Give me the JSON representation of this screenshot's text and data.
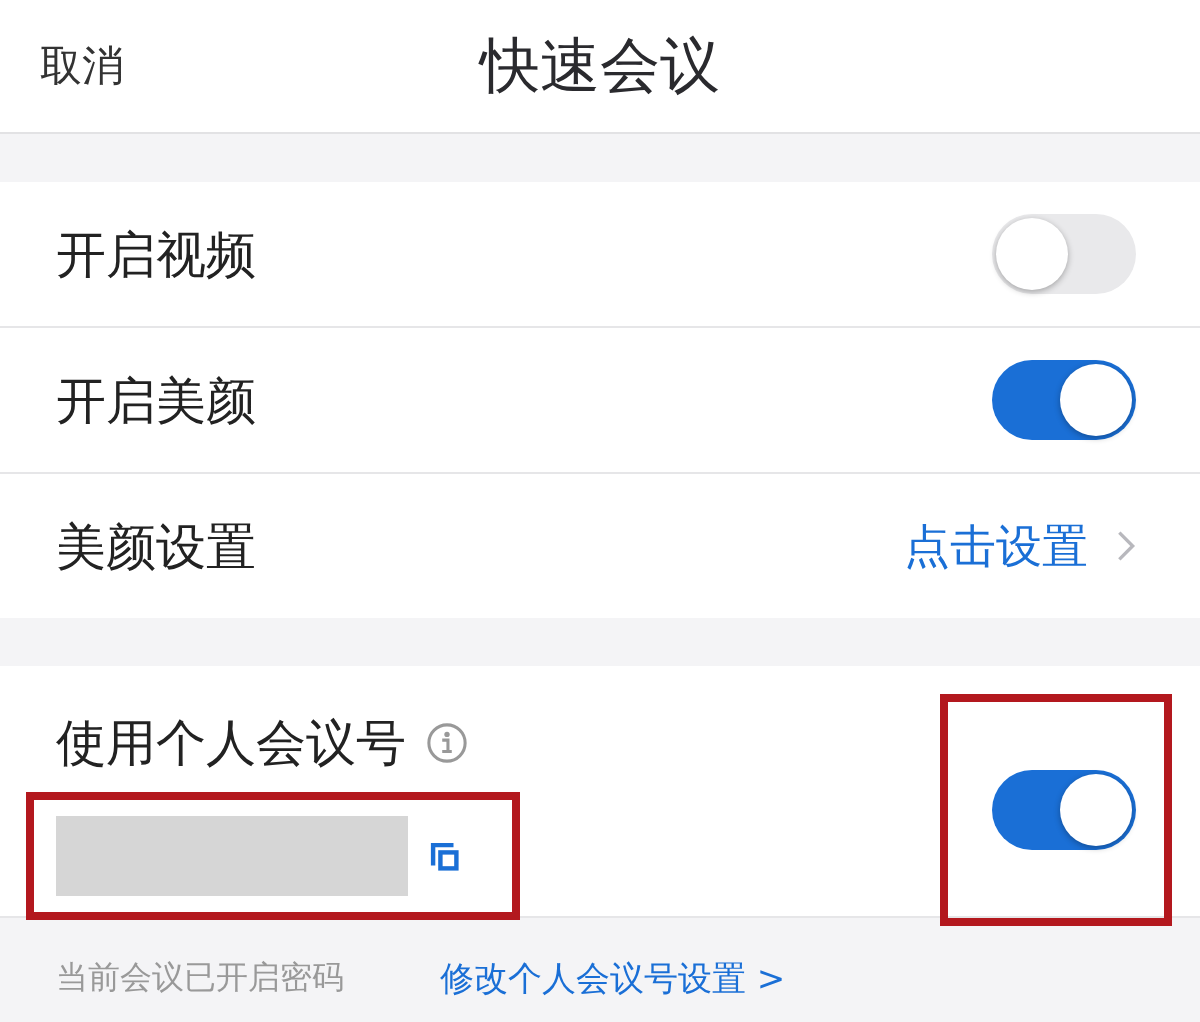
{
  "header": {
    "cancel": "取消",
    "title": "快速会议"
  },
  "settings": [
    {
      "kind": "toggle",
      "label": "开启视频",
      "on": false
    },
    {
      "kind": "toggle",
      "label": "开启美颜",
      "on": true
    },
    {
      "kind": "link",
      "label": "美颜设置",
      "value": "点击设置"
    }
  ],
  "personal": {
    "label": "使用个人会议号",
    "on": true,
    "number_highlighted": true,
    "toggle_highlighted": true
  },
  "footer": {
    "note": "当前会议已开启密码",
    "link": "修改个人会议号设置 >"
  }
}
